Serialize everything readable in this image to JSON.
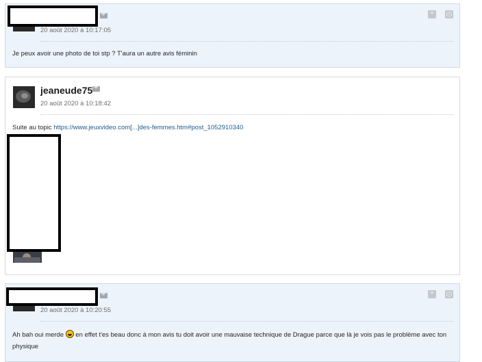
{
  "posts": [
    {
      "author": "",
      "date": "20 août 2020 à 10:17:05",
      "message": "Je peux avoir une photo de toi stp ? T'aura un autre avis féminin"
    },
    {
      "author": "jeaneude75",
      "date": "20 août 2020 à 10:18:42",
      "message_prefix": "Suite au topic ",
      "link": "https://www.jeuxvideo.com[...]des-femmes.htm#post_1052910340"
    },
    {
      "author": "",
      "date": "20 août 2020 à 10:20:55",
      "message_before_smiley": "Ah bah oui merde ",
      "message_after_smiley": " en effet t'es beau donc à mon avis tu doit avoir une mauvaise technique de Drague parce que là je vois pas le problème avec ton physique"
    }
  ],
  "icons": {
    "quote": "quote-icon",
    "report": "report-icon",
    "mail": "mail-icon",
    "smiley": "laughing-smiley-icon"
  },
  "colors": {
    "alt_post_bg": "#ecf3fa",
    "link": "#1f5a8b"
  }
}
